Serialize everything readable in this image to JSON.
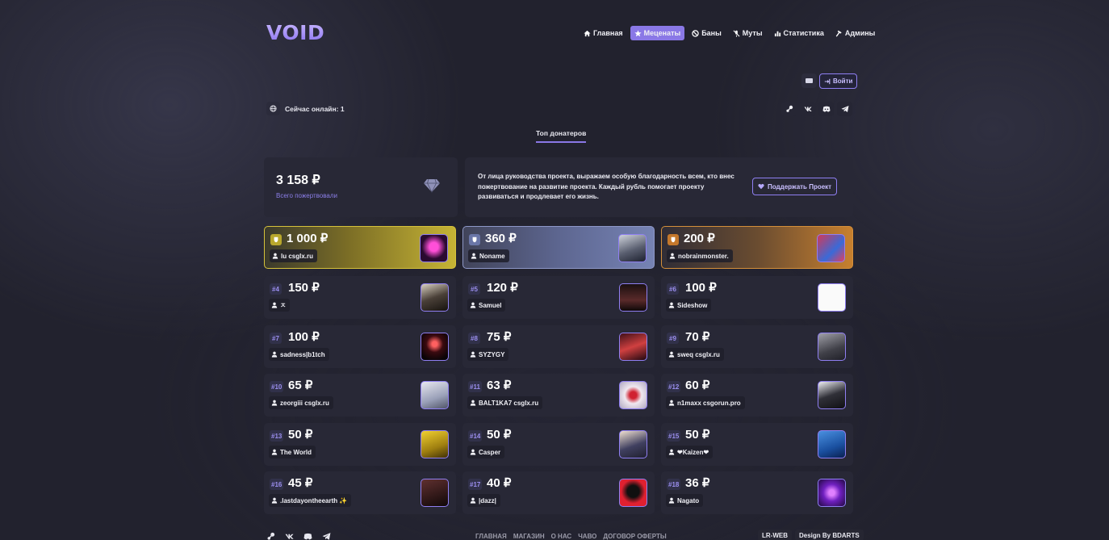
{
  "header": {
    "logo": "VOID",
    "nav": [
      {
        "label": "Главная",
        "icon": "home-icon",
        "active": false
      },
      {
        "label": "Меценаты",
        "icon": "star-icon",
        "active": true
      },
      {
        "label": "Баны",
        "icon": "ban-icon",
        "active": false
      },
      {
        "label": "Муты",
        "icon": "mute-icon",
        "active": false
      },
      {
        "label": "Статистика",
        "icon": "stats-icon",
        "active": false
      },
      {
        "label": "Админы",
        "icon": "hammer-icon",
        "active": false
      }
    ],
    "login_label": "Войти"
  },
  "online": {
    "label": "Сейчас онлайн: 1"
  },
  "tab": {
    "label": "Топ донатеров"
  },
  "total": {
    "amount": "3 158 ₽",
    "label": "Всего пожертвовали"
  },
  "thanks": {
    "text": "От лица руководства проекта, выражаем особую благодарность всем, кто внес пожертвование на развитие проекта. Каждый рубль помогает проекту развиваться и продлевает его жизнь.",
    "button_label": "Поддержать Проект"
  },
  "donors": [
    {
      "rank": "",
      "amount": "1 000 ₽",
      "name": "lu csglx.ru"
    },
    {
      "rank": "",
      "amount": "360 ₽",
      "name": "Noname"
    },
    {
      "rank": "",
      "amount": "200 ₽",
      "name": "nobrainmonster."
    },
    {
      "rank": "#4",
      "amount": "150 ₽",
      "name": "ㅈ"
    },
    {
      "rank": "#5",
      "amount": "120 ₽",
      "name": "Samuel"
    },
    {
      "rank": "#6",
      "amount": "100 ₽",
      "name": "Sideshow"
    },
    {
      "rank": "#7",
      "amount": "100 ₽",
      "name": "sadness|b1tch"
    },
    {
      "rank": "#8",
      "amount": "75 ₽",
      "name": "SYZYGY"
    },
    {
      "rank": "#9",
      "amount": "70 ₽",
      "name": "sweq csglx.ru"
    },
    {
      "rank": "#10",
      "amount": "65 ₽",
      "name": "zeorgiii csglx.ru"
    },
    {
      "rank": "#11",
      "amount": "63 ₽",
      "name": "BALT1KA7 csglx.ru"
    },
    {
      "rank": "#12",
      "amount": "60 ₽",
      "name": "n1maxx csgorun.pro"
    },
    {
      "rank": "#13",
      "amount": "50 ₽",
      "name": "The World"
    },
    {
      "rank": "#14",
      "amount": "50 ₽",
      "name": "Casper"
    },
    {
      "rank": "#15",
      "amount": "50 ₽",
      "name": "❤Kaizen❤"
    },
    {
      "rank": "#16",
      "amount": "45 ₽",
      "name": ".lastdayontheearth ✨"
    },
    {
      "rank": "#17",
      "amount": "40 ₽",
      "name": "|dazz|"
    },
    {
      "rank": "#18",
      "amount": "36 ₽",
      "name": "Nagato"
    }
  ],
  "footer": {
    "links": [
      "ГЛАВНАЯ",
      "МАГАЗИН",
      "О НАС",
      "ЧАВО",
      "ДОГОВОР ОФЕРТЫ"
    ],
    "tags": [
      "LR-WEB",
      "Design By BDARTS"
    ]
  },
  "colors": {
    "accent": "#8a78e6",
    "gold": "#c6b435",
    "silver": "#7683b4",
    "bronze": "#c7802f",
    "card": "#282836"
  }
}
